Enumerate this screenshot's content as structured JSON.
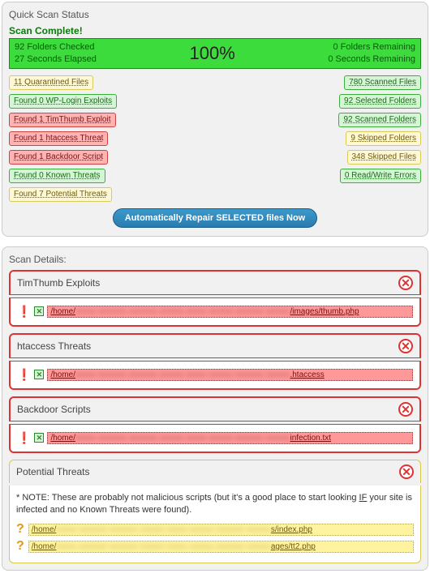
{
  "status_title": "Quick Scan Status",
  "scan_complete": "Scan Complete!",
  "progress": {
    "folders_checked": "92 Folders Checked",
    "seconds_elapsed": "27 Seconds Elapsed",
    "percent": "100%",
    "folders_remaining": "0 Folders Remaining",
    "seconds_remaining": "0 Seconds Remaining"
  },
  "left_badges": [
    {
      "text": "11 Quarantined Files",
      "cls": "b-yellow"
    },
    {
      "text": "Found 0 WP-Login Exploits",
      "cls": "b-green"
    },
    {
      "text": "Found 1 TimThumb Exploit",
      "cls": "b-red"
    },
    {
      "text": "Found 1 htaccess Threat",
      "cls": "b-red"
    },
    {
      "text": "Found 1 Backdoor Script",
      "cls": "b-red"
    },
    {
      "text": "Found 0 Known Threats",
      "cls": "b-green"
    },
    {
      "text": "Found 7 Potential Threats",
      "cls": "b-yellow"
    }
  ],
  "right_badges": [
    {
      "text": "780 Scanned Files",
      "cls": "b-green"
    },
    {
      "text": "92 Selected Folders",
      "cls": "b-green"
    },
    {
      "text": "92 Scanned Folders",
      "cls": "b-green"
    },
    {
      "text": "9 Skipped Folders",
      "cls": "b-yellow"
    },
    {
      "text": "348 Skipped Files",
      "cls": "b-yellow"
    },
    {
      "text": "0 Read/Write Errors",
      "cls": "b-green"
    }
  ],
  "repair_btn": "Automatically Repair SELECTED files Now",
  "details_title": "Scan Details:",
  "sections": [
    {
      "title": "TimThumb Exploits",
      "prefix": "/home/",
      "suffix": "/images/thumb.php"
    },
    {
      "title": "htaccess Threats",
      "prefix": "/home/",
      "suffix": ".htaccess"
    },
    {
      "title": "Backdoor Scripts",
      "prefix": "/home/",
      "suffix": "infection.txt"
    }
  ],
  "potential": {
    "title": "Potential Threats",
    "note": "* NOTE: These are probably not malicious scripts (but it's a good place to start looking IF your site is infected and no Known Threats were found).",
    "rows": [
      {
        "prefix": "/home/",
        "suffix": "s/index.php"
      },
      {
        "prefix": "/home/",
        "suffix": "ages/tt2.php"
      }
    ]
  }
}
